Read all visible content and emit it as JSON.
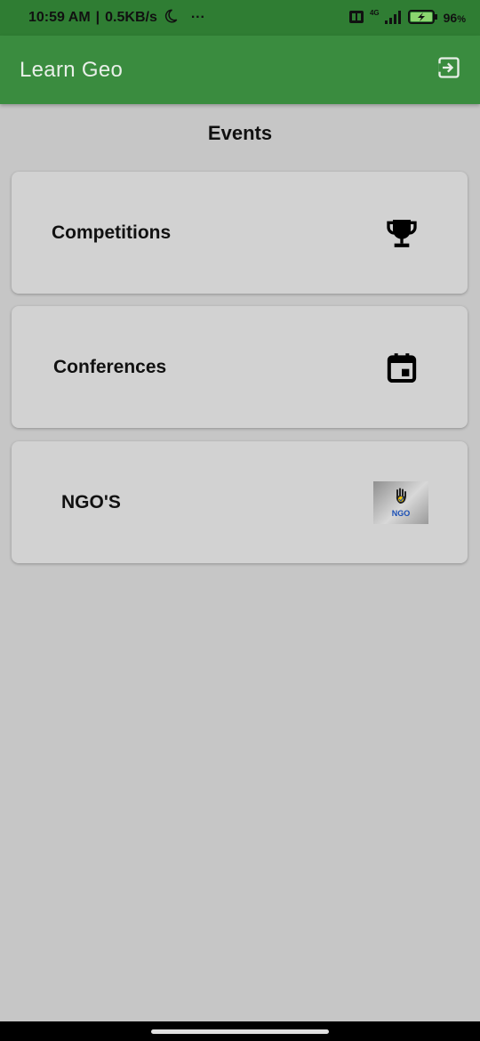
{
  "status_bar": {
    "time": "10:59 AM",
    "network_speed": "0.5KB/s",
    "dots": "···",
    "network_type": "4G",
    "battery": "96",
    "battery_unit": "%"
  },
  "app_bar": {
    "title": "Learn Geo",
    "logout_icon": "exit-to-app-icon"
  },
  "page": {
    "section_title": "Events"
  },
  "cards": [
    {
      "label": "Competitions",
      "icon": "trophy-icon"
    },
    {
      "label": "Conferences",
      "icon": "calendar-icon"
    },
    {
      "label": "NGO'S",
      "icon": "ngo-logo",
      "logo_text": "NGO"
    }
  ],
  "colors": {
    "app_bar": "#3a8c3f",
    "status_bar": "#2f7d33",
    "background": "#c6c6c6",
    "card": "#d2d2d2"
  }
}
